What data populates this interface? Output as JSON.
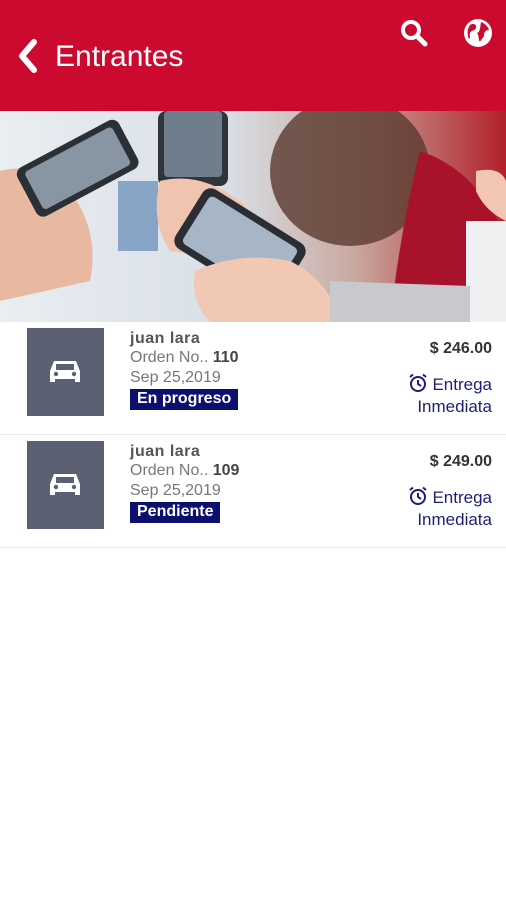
{
  "header": {
    "title": "Entrantes",
    "back_icon": "chevron-left-icon",
    "search_icon": "search-icon",
    "globe_icon": "globe-icon",
    "bg_color": "#cc0a2f"
  },
  "banner": {
    "image": "people-using-smartphones-photo"
  },
  "orders": [
    {
      "customer": "juan lara",
      "order_label": "Orden No..",
      "order_number": "110",
      "date": "Sep 25,2019",
      "status": "En progreso",
      "price": "$ 246.00",
      "delivery_line1": "Entrega",
      "delivery_line2": "Inmediata",
      "icon": "car-icon"
    },
    {
      "customer": "juan lara",
      "order_label": "Orden No..",
      "order_number": "109",
      "date": "Sep 25,2019",
      "status": "Pendiente",
      "price": "$ 249.00",
      "delivery_line1": "Entrega",
      "delivery_line2": "Inmediata",
      "icon": "car-icon"
    }
  ]
}
